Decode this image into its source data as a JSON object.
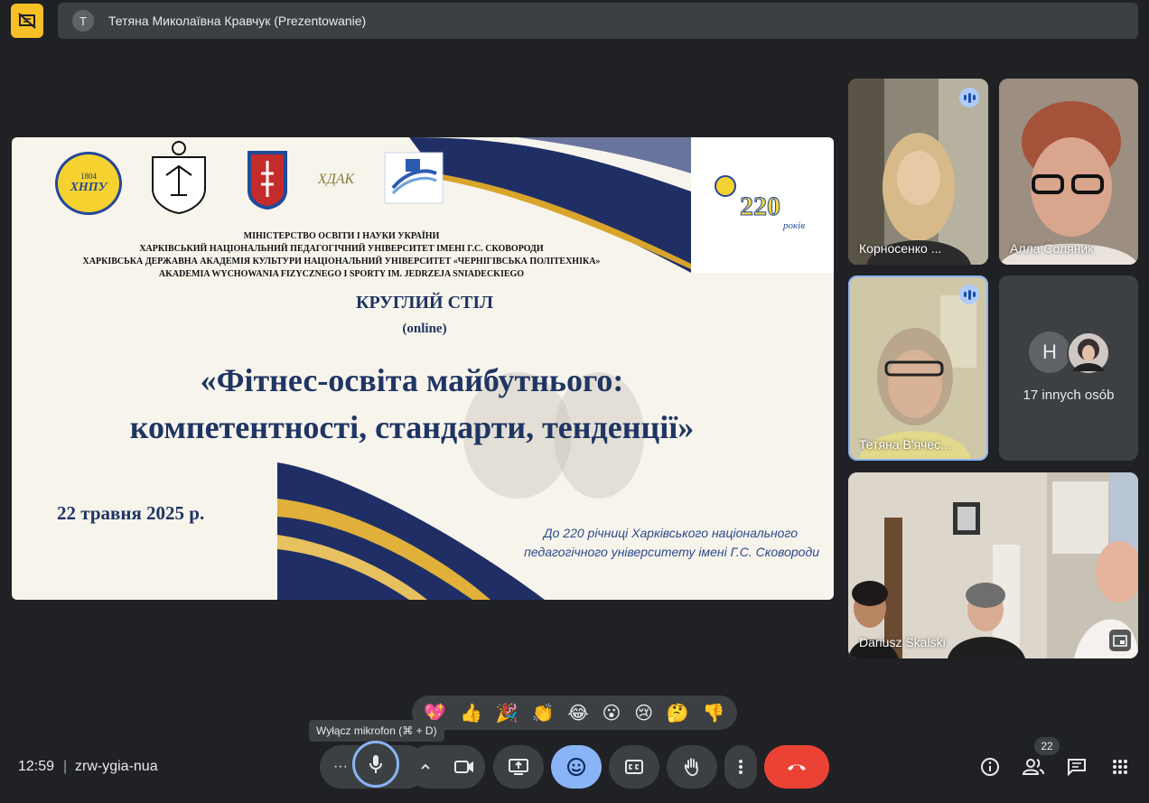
{
  "header": {
    "presenter_avatar_letter": "T",
    "presenter_title": "Тетяна Миколаївна Кравчук (Prezentowanie)"
  },
  "slide": {
    "org_lines": [
      "МІНІСТЕРСТВО ОСВІТИ І НАУКИ УКРАЇНИ",
      "ХАРКІВСЬКИЙ НАЦІОНАЛЬНИЙ ПЕДАГОГІЧНИЙ УНІВЕРСИТЕТ ІМЕНІ Г.С. СКОВОРОДИ",
      "ХАРКІВСЬКА ДЕРЖАВНА АКАДЕМІЯ КУЛЬТУРИ НАЦІОНАЛЬНИЙ УНІВЕРСИТЕТ «ЧЕРНІГІВСЬКА ПОЛІТЕХНІКА»",
      "AKADEMIA WYCHOWANIA FIZYCZNEGO I SPORTY  IM. JEDRZEJA SNIADECKIEGO"
    ],
    "event_type": "КРУГЛИЙ СТІЛ",
    "event_mode": "(online)",
    "title_line1": "«Фітнес-освіта майбутнього:",
    "title_line2": "компетентності, стандарти, тенденції»",
    "date": "22 травня 2025 р.",
    "dedication_line1": "До 220 річниці Харківського національного",
    "dedication_line2": "педагогічного університету імені Г.С. Сковороди",
    "anniversary_number": "220",
    "anniversary_word": "років",
    "logo_hnpu_year": "1804",
    "logo_hnpu_text": "ХНПУ",
    "logo_hdak_text": "ХДАК"
  },
  "participants": [
    {
      "name": "Корносенко ...",
      "speaking": true
    },
    {
      "name": "Алла Соляник",
      "speaking": false
    },
    {
      "name": "Тетяна В'ячес...",
      "speaking": true
    },
    {
      "name": "Dariusz Skalski",
      "speaking": false
    }
  ],
  "others": {
    "avatar_letter": "H",
    "label": "17 innych osób"
  },
  "reactions": [
    "💖",
    "👍",
    "🎉",
    "👏",
    "😂",
    "😮",
    "😢",
    "🤔",
    "👎"
  ],
  "tooltip": "Wyłącz mikrofon (⌘ + D)",
  "footer": {
    "time": "12:59",
    "separator": "|",
    "meeting_code": "zrw-ygia-nua",
    "more_dots": "···"
  },
  "people_count": "22",
  "colors": {
    "background": "#202124",
    "accent_yellow": "#f6c026",
    "hangup_red": "#ea4335",
    "active_blue": "#8ab4f8",
    "slide_navy": "#1f3563"
  }
}
